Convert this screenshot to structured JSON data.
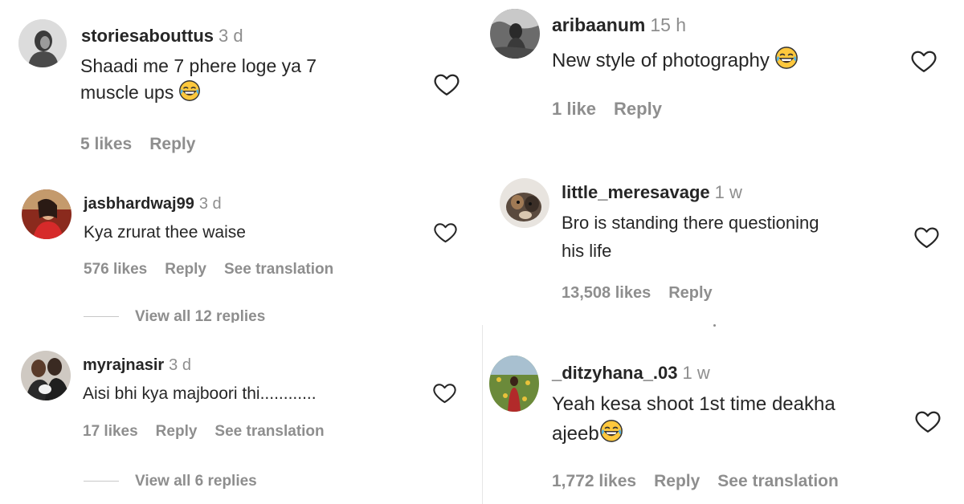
{
  "left": {
    "comments": [
      {
        "username": "storiesabouttus",
        "time": "3 d",
        "text_line1": "Shaadi me 7 phere loge ya 7",
        "text_line2": "muscle ups",
        "emoji": "laughing-tears",
        "likes": "5 likes",
        "reply": "Reply",
        "liked": false
      },
      {
        "username": "jasbhardwaj99",
        "time": "3 d",
        "text_line1": "Kya zrurat thee waise",
        "likes": "576 likes",
        "reply": "Reply",
        "translation": "See translation",
        "view_replies": "View all 12 replies",
        "liked": false
      },
      {
        "username": "myrajnasir",
        "time": "3 d",
        "text_line1": "Aisi bhi kya majboori thi............",
        "likes": "17 likes",
        "reply": "Reply",
        "translation": "See translation",
        "view_replies": "View all 6 replies",
        "liked": false
      }
    ]
  },
  "right": {
    "comments": [
      {
        "username": "aribaanum",
        "time": "15 h",
        "text_line1": "New style of photography",
        "emoji": "laughing-tears",
        "likes": "1 like",
        "reply": "Reply",
        "liked": false
      },
      {
        "username": "little_meresavage",
        "time": "1 w",
        "text_line1": "Bro is standing there questioning",
        "text_line2": "his life",
        "likes": "13,508 likes",
        "reply": "Reply",
        "liked": false
      },
      {
        "username": "_ditzyhana_.03",
        "time": "1 w",
        "text_line1": "Yeah kesa shoot 1st time deakha",
        "text_line2": "ajeeb",
        "emoji": "laughing-tears",
        "likes": "1,772 likes",
        "reply": "Reply",
        "translation": "See translation",
        "liked": false
      }
    ]
  },
  "colors": {
    "text": "#262626",
    "muted": "#8e8e8e",
    "emoji_face": "#ffc83d"
  }
}
